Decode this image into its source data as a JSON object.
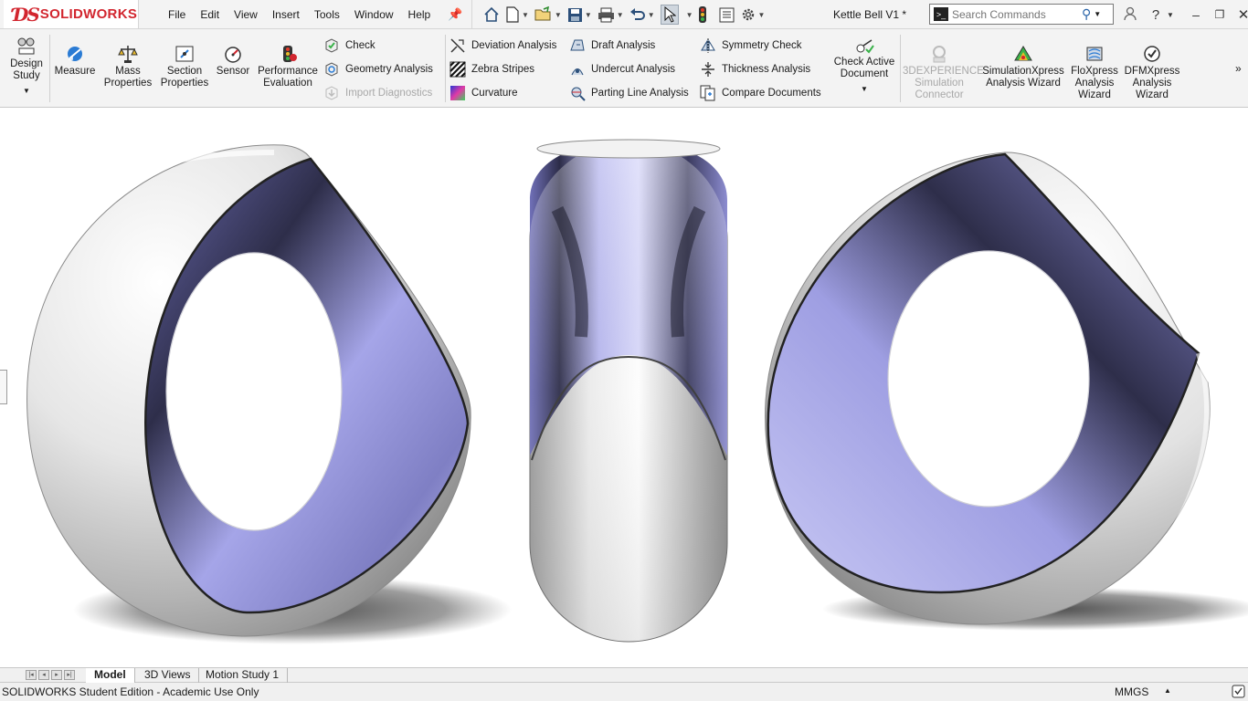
{
  "app": {
    "brand": "SOLIDWORKS",
    "doc_title": "Kettle Bell V1 *"
  },
  "menu": [
    "File",
    "Edit",
    "View",
    "Insert",
    "Tools",
    "Window",
    "Help"
  ],
  "search": {
    "placeholder": "Search Commands"
  },
  "ribbon": {
    "design_study": "Design Study",
    "measure": "Measure",
    "mass_properties": "Mass Properties",
    "section_properties": "Section Properties",
    "sensor": "Sensor",
    "performance_evaluation": "Performance Evaluation",
    "check": "Check",
    "geometry_analysis": "Geometry Analysis",
    "import_diagnostics": "Import Diagnostics",
    "deviation_analysis": "Deviation Analysis",
    "zebra_stripes": "Zebra Stripes",
    "curvature": "Curvature",
    "draft_analysis": "Draft Analysis",
    "undercut_analysis": "Undercut Analysis",
    "parting_line_analysis": "Parting Line Analysis",
    "symmetry_check": "Symmetry Check",
    "thickness_analysis": "Thickness Analysis",
    "compare_documents": "Compare Documents",
    "check_active_document": "Check Active Document",
    "experience_connector": "3DEXPERIENCE Simulation Connector",
    "simulationxpress": "SimulationXpress Analysis Wizard",
    "floxpress": "FloXpress Analysis Wizard",
    "dfmxpress": "DFMXpress Analysis Wizard"
  },
  "tabs": [
    "Model",
    "3D Views",
    "Motion Study 1"
  ],
  "status": {
    "text": "SOLIDWORKS Student Edition - Academic Use Only",
    "units": "MMGS"
  },
  "colors": {
    "brand_red": "#d2262f",
    "surface_blue": "#8f8fd8",
    "toolbar_bg": "#f3f3f3"
  }
}
